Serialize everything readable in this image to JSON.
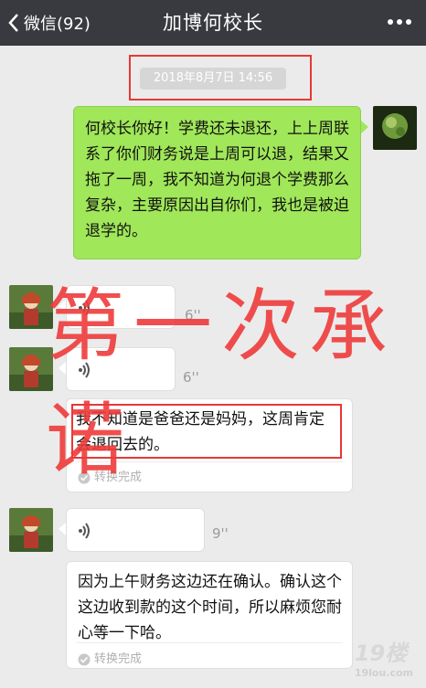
{
  "header": {
    "back_label": "微信(92)",
    "title": "加博何校长"
  },
  "timestamp": "2018年8月7日 14:56",
  "messages": {
    "m1": "何校长你好！学费还未退还，上上周联系了你们财务说是上周可以退，结果又拖了一周，我不知道为何退个学费那么复杂，主要原因出自你们，我也是被迫退学的。",
    "v1_duration": "6''",
    "v2_duration": "6''",
    "t1": "我不知道是爸爸还是妈妈，这周肯定会退回去的。",
    "t1_status": "转换完成",
    "v3_duration": "9''",
    "t2": "因为上午财务这边还在确认。确认这个这边收到款的这个时间，所以麻烦您耐心等一下哈。",
    "t2_status": "转换完成"
  },
  "annotation": {
    "handwriting": "第一次承诺"
  },
  "watermark": {
    "logo": "19楼",
    "site": "19lou.com"
  }
}
